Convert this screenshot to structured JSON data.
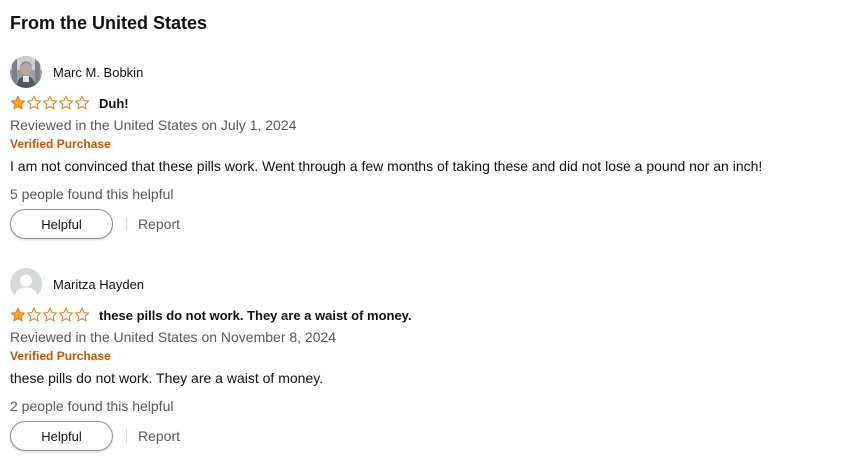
{
  "section": {
    "title": "From the United States"
  },
  "reviews": [
    {
      "profile_name": "Marc M. Bobkin",
      "avatar": "user-photo",
      "rating": 1,
      "rating_max": 5,
      "title": "Duh!",
      "date_text": "Reviewed in the United States on July 1, 2024",
      "verified_label": "Verified Purchase",
      "body": "I am not convinced that these pills work. Went through a few months of taking these and did not lose a pound nor an inch!",
      "helpful_text": "5 people found this helpful",
      "helpful_button": "Helpful",
      "report_label": "Report"
    },
    {
      "profile_name": "Maritza Hayden",
      "avatar": "default-person-icon",
      "rating": 1,
      "rating_max": 5,
      "title": "these pills do not work. They are a waist of money.",
      "date_text": "Reviewed in the United States on November 8, 2024",
      "verified_label": "Verified Purchase",
      "body": "these pills do not work. They are a waist of money.",
      "helpful_text": "2 people found this helpful",
      "helpful_button": "Helpful",
      "report_label": "Report"
    }
  ],
  "colors": {
    "text": "#0f1111",
    "secondary_text": "#565959",
    "verified": "#c45500",
    "star_fill": "#ffa41c",
    "star_stroke": "#de7921",
    "button_border": "#8d9096",
    "divider": "#d5d9d9"
  }
}
